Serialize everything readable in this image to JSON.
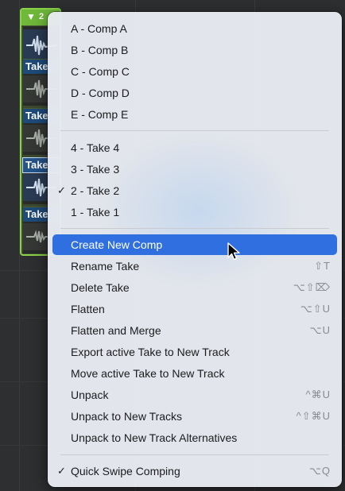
{
  "take_folder": {
    "header_number": "2",
    "takes": [
      {
        "label": "Take",
        "active": false
      },
      {
        "label": "Take",
        "active": false
      },
      {
        "label": "Take",
        "active": true
      },
      {
        "label": "Take",
        "active": false
      }
    ]
  },
  "menu": {
    "comps": [
      "A - Comp A",
      "B - Comp B",
      "C - Comp C",
      "D - Comp D",
      "E - Comp E"
    ],
    "takes": [
      {
        "label": "4 - Take 4",
        "checked": false
      },
      {
        "label": "3 - Take 3",
        "checked": false
      },
      {
        "label": "2 - Take 2",
        "checked": true
      },
      {
        "label": "1 - Take 1",
        "checked": false
      }
    ],
    "actions": [
      {
        "label": "Create New Comp",
        "shortcut": "",
        "highlighted": true
      },
      {
        "label": "Rename Take",
        "shortcut": "⇧T"
      },
      {
        "label": "Delete Take",
        "shortcut": "⌥⇧⌦"
      },
      {
        "label": "Flatten",
        "shortcut": "⌥⇧U"
      },
      {
        "label": "Flatten and Merge",
        "shortcut": "⌥U"
      },
      {
        "label": "Export active Take to New Track",
        "shortcut": ""
      },
      {
        "label": "Move active Take to New Track",
        "shortcut": ""
      },
      {
        "label": "Unpack",
        "shortcut": "^⌘U"
      },
      {
        "label": "Unpack to New Tracks",
        "shortcut": "^⇧⌘U"
      },
      {
        "label": "Unpack to New Track Alternatives",
        "shortcut": ""
      }
    ],
    "quick_swipe": {
      "label": "Quick Swipe Comping",
      "shortcut": "⌥Q",
      "checked": true
    },
    "check_glyph": "✓"
  },
  "colors": {
    "highlight": "#2f6fe0",
    "take_folder_border": "#8bd34a",
    "take_label_bg": "#1f4b7a"
  }
}
